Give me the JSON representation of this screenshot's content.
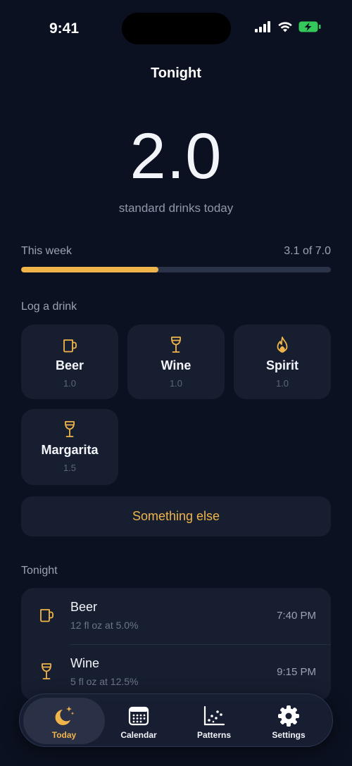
{
  "status_bar": {
    "time": "9:41"
  },
  "header": {
    "title": "Tonight"
  },
  "summary": {
    "value": "2.0",
    "caption": "standard drinks today"
  },
  "week": {
    "label": "This week",
    "progress_text": "3.1 of 7.0",
    "progress_fraction": 0.443
  },
  "log_section": {
    "label": "Log a drink",
    "drinks": [
      {
        "name": "Beer",
        "value": "1.0",
        "icon": "mug-icon"
      },
      {
        "name": "Wine",
        "value": "1.0",
        "icon": "wine-glass-icon"
      },
      {
        "name": "Spirit",
        "value": "1.0",
        "icon": "flame-icon"
      },
      {
        "name": "Margarita",
        "value": "1.5",
        "icon": "wine-glass-icon"
      }
    ],
    "other_label": "Something else"
  },
  "tonight": {
    "label": "Tonight",
    "entries": [
      {
        "name": "Beer",
        "detail": "12 fl oz at 5.0%",
        "time": "7:40 PM",
        "icon": "mug-icon"
      },
      {
        "name": "Wine",
        "detail": "5 fl oz at 12.5%",
        "time": "9:15 PM",
        "icon": "wine-glass-icon"
      }
    ]
  },
  "tabbar": {
    "tabs": [
      {
        "label": "Today",
        "icon": "moon-stars-icon",
        "active": true
      },
      {
        "label": "Calendar",
        "icon": "calendar-icon",
        "active": false
      },
      {
        "label": "Patterns",
        "icon": "scatter-chart-icon",
        "active": false
      },
      {
        "label": "Settings",
        "icon": "gear-icon",
        "active": false
      }
    ]
  },
  "colors": {
    "accent": "#f0b54a",
    "background": "#0b1120",
    "card": "#171e30",
    "battery": "#34c759"
  }
}
